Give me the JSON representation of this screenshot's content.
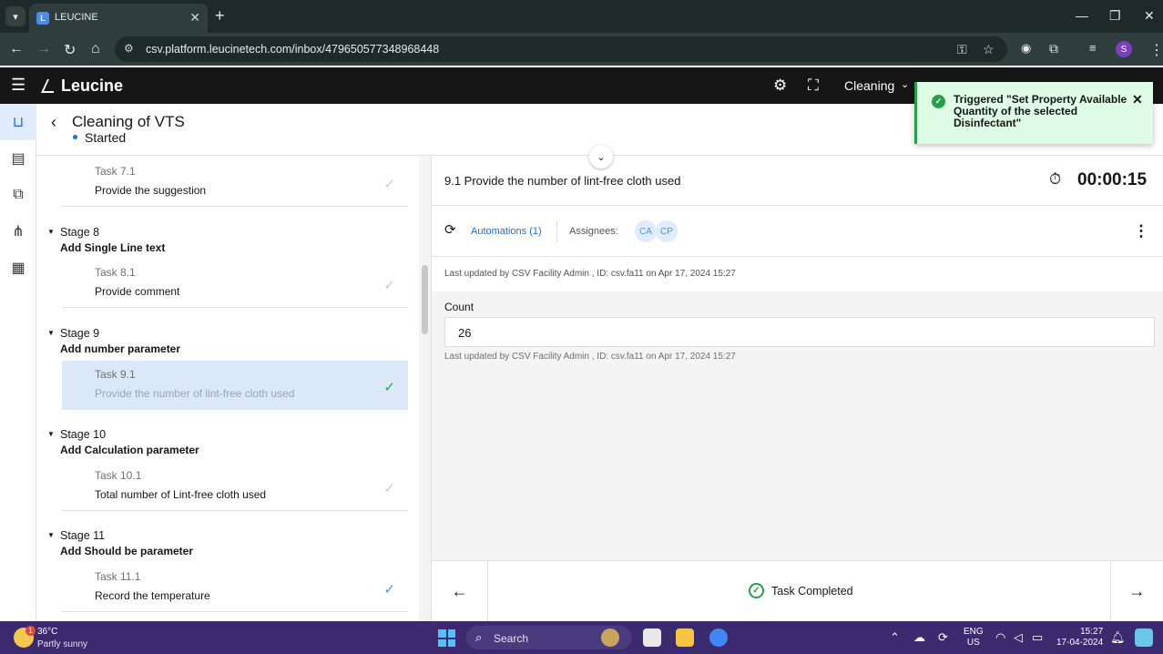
{
  "browser": {
    "tab_title": "LEUCINE",
    "url": "csv.platform.leucinetech.com/inbox/479650577348968448"
  },
  "header": {
    "brand": "Leucine",
    "facility": "Cleaning"
  },
  "job": {
    "title": "Cleaning of VTS",
    "status": "Started"
  },
  "stages": [
    {
      "name": "",
      "title": "",
      "task_number": "Task 7.1",
      "task_name": "Provide the suggestion",
      "check": "grey"
    },
    {
      "name": "Stage 8",
      "title": "Add Single Line text",
      "task_number": "Task 8.1",
      "task_name": "Provide comment",
      "check": "grey"
    },
    {
      "name": "Stage 9",
      "title": "Add number parameter",
      "task_number": "Task 9.1",
      "task_name": "Provide the number of lint-free cloth used",
      "check": "green",
      "active": true
    },
    {
      "name": "Stage 10",
      "title": "Add Calculation parameter",
      "task_number": "Task 10.1",
      "task_name": "Total number of Lint-free cloth used",
      "check": "grey"
    },
    {
      "name": "Stage 11",
      "title": "Add Should be parameter",
      "task_number": "Task 11.1",
      "task_name": "Record the temperature",
      "check": "blue"
    }
  ],
  "task_panel": {
    "title": "9.1 Provide the number of lint-free cloth used",
    "timer": "00:00:15",
    "automations_label": "Automations (1)",
    "assignees_label": "Assignees:",
    "assignees": [
      "CA",
      "CP"
    ],
    "last_updated": "Last updated by CSV Facility Admin , ID: csv.fa11 on Apr 17, 2024 15:27",
    "parameter_label": "Count",
    "parameter_value": "26",
    "parameter_updated": "Last updated by CSV Facility Admin , ID: csv.fa11 on Apr 17, 2024 15:27",
    "footer_status": "Task Completed"
  },
  "toast": {
    "message": "Triggered \"Set Property Available Quantity of the selected Disinfectant\""
  },
  "taskbar": {
    "temperature": "36°C",
    "weather": "Partly sunny",
    "weather_badge": "1",
    "search_placeholder": "Search",
    "lang_top": "ENG",
    "lang_bottom": "US",
    "time": "15:27",
    "date": "17-04-2024"
  },
  "colors": {
    "accent": "#1d6fd6",
    "success": "#24a148",
    "header_bg": "#161616"
  }
}
